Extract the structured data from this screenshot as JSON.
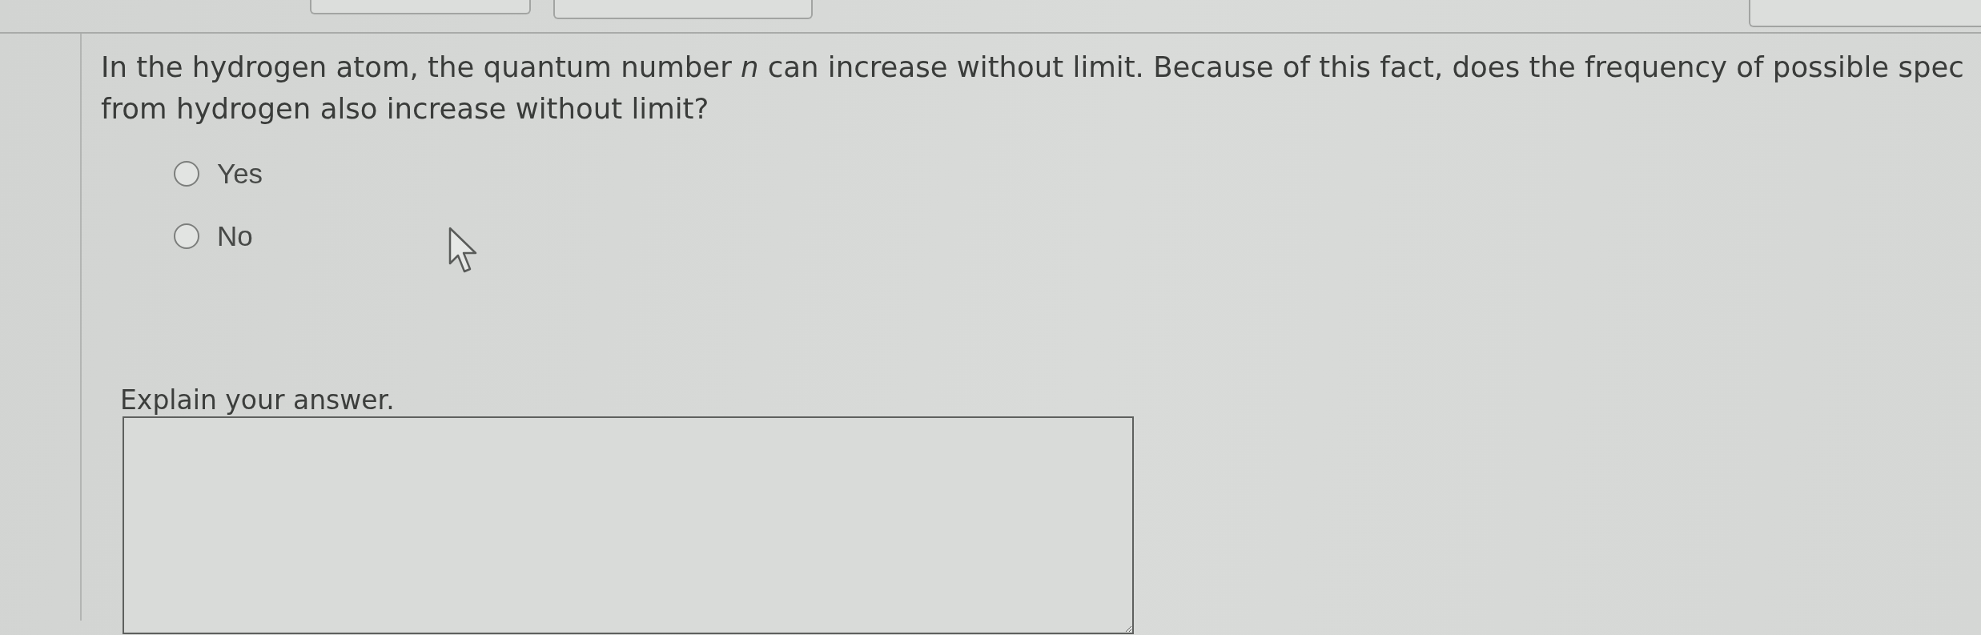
{
  "question": {
    "text": "In the hydrogen atom, the quantum number *n* can increase without limit. Because of this fact, does the frequency of possible spec from hydrogen also increase without limit?"
  },
  "options": [
    {
      "label": "Yes",
      "selected": false
    },
    {
      "label": "No",
      "selected": false
    }
  ],
  "explanation": {
    "prompt": "Explain your answer."
  }
}
